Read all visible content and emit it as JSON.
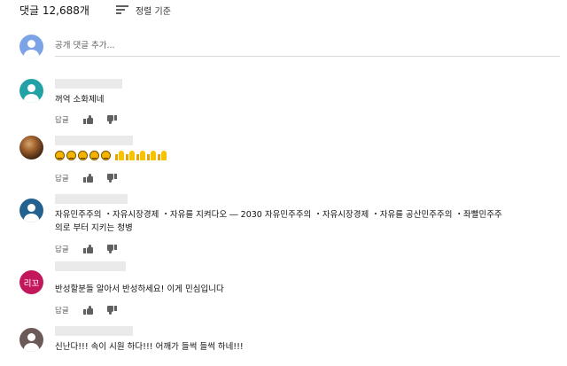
{
  "header": {
    "comment_count": "댓글 12,688개",
    "sort_label": "정렬 기준",
    "sort_icon": "sort-icon"
  },
  "add_comment": {
    "placeholder": "공개 댓글 추가..."
  },
  "comment_actions": {
    "reply_label": "답글",
    "like_icon": "thumbs-up-icon",
    "dislike_icon": "thumbs-down-icon"
  },
  "comments": [
    {
      "avatar": "user-avatar",
      "avatar_color": "#23a2a6",
      "text": "꺼억 소화제네"
    },
    {
      "avatar": "photo-avatar",
      "emoji_count": 5,
      "thumbs_count": 5
    },
    {
      "avatar": "user-avatar",
      "avatar_color": "#23628f",
      "line1": "자유민주주의 ・자유시장경제 ・자유를 지켜다오 ― 2030 자유민주주의 ・자유시장경제 ・자유를 공산민주주의 ・좌빨민주주",
      "line2": "의로 부터 지키는 청병"
    },
    {
      "avatar_initials": "리꼬",
      "avatar_color": "#c2185b",
      "text": "반성할분들 알아서 반성하세요! 이게 민심입니다"
    },
    {
      "avatar": "user-avatar",
      "avatar_color": "#6b5a57",
      "text": "신난다!!!    속이 시원 하다!!!    어깨가 들썩 들썩 하네!!!"
    }
  ]
}
